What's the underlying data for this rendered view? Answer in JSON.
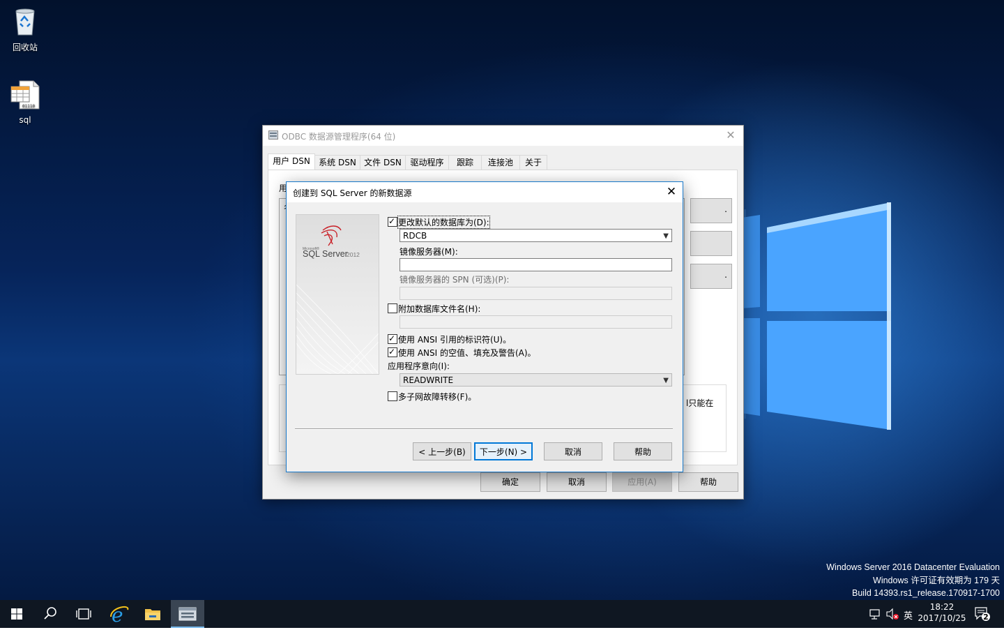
{
  "desktop": {
    "icons": [
      {
        "label": "回收站",
        "icon": "recycle-bin-icon"
      },
      {
        "label": "sql",
        "icon": "sql-file-icon"
      }
    ],
    "watermark": {
      "line1": "Windows Server 2016 Datacenter Evaluation",
      "line2": "Windows 许可证有效期为 179 天",
      "line3": "Build 14393.rs1_release.170917-1700"
    }
  },
  "odbc": {
    "title": "ODBC 数据源管理程序(64 位)",
    "tabs": [
      "用户 DSN",
      "系统 DSN",
      "文件 DSN",
      "驱动程序",
      "跟踪",
      "连接池",
      "关于"
    ],
    "panel_label_partial": "用",
    "panel_list_partial": "名",
    "side_buttons_partial": [
      ".",
      "",
      "."
    ],
    "group_text_partial": "l只能在",
    "buttons": {
      "ok": "确定",
      "cancel": "取消",
      "apply": "应用(A)",
      "help": "帮助"
    }
  },
  "wizard": {
    "title": "创建到 SQL Server 的新数据源",
    "banner": {
      "brand_small": "Microsoft®",
      "brand": "SQL Server",
      "version": "2012"
    },
    "change_default_db": {
      "label": "更改默认的数据库为(D):",
      "checked": true
    },
    "default_db_value": "RDCB",
    "mirror_server_label": "镜像服务器(M):",
    "mirror_server_value": "",
    "mirror_spn_label": "镜像服务器的 SPN (可选)(P):",
    "mirror_spn_value": "",
    "attach_db": {
      "label": "附加数据库文件名(H):",
      "checked": false
    },
    "attach_db_value": "",
    "ansi_quoted": {
      "label": "使用 ANSI 引用的标识符(U)。",
      "checked": true
    },
    "ansi_nulls": {
      "label": "使用 ANSI 的空值、填充及警告(A)。",
      "checked": true
    },
    "app_intent_label": "应用程序意向(I):",
    "app_intent_value": "READWRITE",
    "multisubnet": {
      "label": "多子网故障转移(F)。",
      "checked": false
    },
    "buttons": {
      "back": "< 上一步(B)",
      "next": "下一步(N) >",
      "cancel": "取消",
      "help": "帮助"
    }
  },
  "taskbar": {
    "items": [
      "start-icon",
      "search-icon",
      "task-view-icon",
      "internet-explorer-icon",
      "file-explorer-icon",
      "odbc-app-icon"
    ],
    "ime": "英",
    "time": "18:22",
    "date": "2017/10/25",
    "notification_count": "2"
  }
}
